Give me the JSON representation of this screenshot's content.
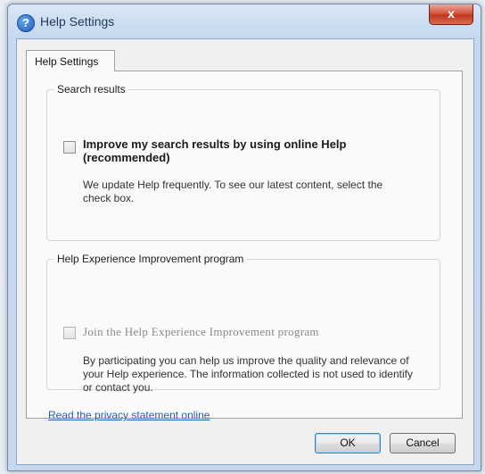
{
  "window": {
    "title": "Help Settings",
    "icon": "help-question-icon",
    "close_label": "x"
  },
  "tab": {
    "label": "Help Settings"
  },
  "search_group": {
    "title": "Search results",
    "checkbox_label": "Improve my search results by using online Help (recommended)",
    "checked": false,
    "description": "We update Help frequently. To see our latest content, select the check box."
  },
  "experience_group": {
    "title": "Help Experience Improvement program",
    "checkbox_label": "Join the Help Experience Improvement program",
    "checked": false,
    "disabled": true,
    "description": "By participating you can help us improve the quality and relevance of your Help experience. The information collected is not used to identify or contact you."
  },
  "privacy_link": "Read the privacy statement online",
  "buttons": {
    "ok": "OK",
    "cancel": "Cancel"
  }
}
